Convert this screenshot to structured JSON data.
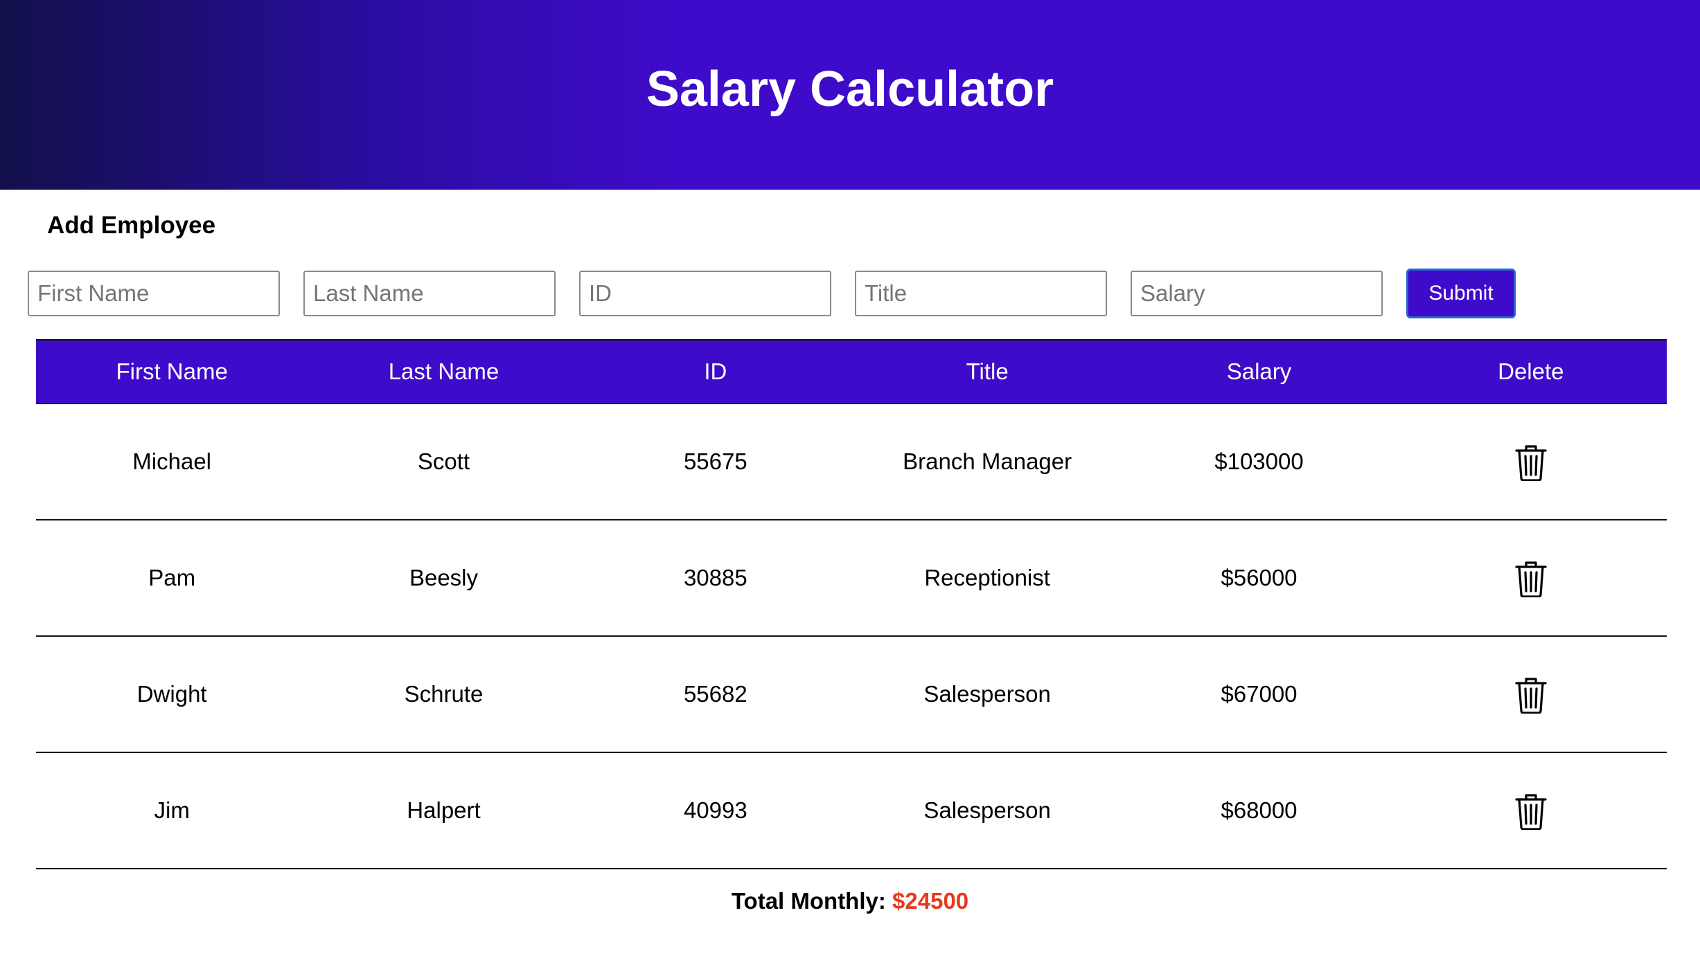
{
  "header": {
    "title": "Salary Calculator"
  },
  "form": {
    "title": "Add Employee",
    "first_name_placeholder": "First Name",
    "last_name_placeholder": "Last Name",
    "id_placeholder": "ID",
    "title_placeholder": "Title",
    "salary_placeholder": "Salary",
    "submit_label": "Submit"
  },
  "table": {
    "headers": [
      "First Name",
      "Last Name",
      "ID",
      "Title",
      "Salary",
      "Delete"
    ],
    "rows": [
      {
        "first": "Michael",
        "last": "Scott",
        "id": "55675",
        "title": "Branch Manager",
        "salary": "$103000",
        "delete_icon": "trash-icon"
      },
      {
        "first": "Pam",
        "last": "Beesly",
        "id": "30885",
        "title": "Receptionist",
        "salary": "$56000",
        "delete_icon": "trash-icon"
      },
      {
        "first": "Dwight",
        "last": "Schrute",
        "id": "55682",
        "title": "Salesperson",
        "salary": "$67000",
        "delete_icon": "trash-icon"
      },
      {
        "first": "Jim",
        "last": "Halpert",
        "id": "40993",
        "title": "Salesperson",
        "salary": "$68000",
        "delete_icon": "trash-icon"
      }
    ]
  },
  "footer": {
    "total_label": "Total Monthly:",
    "total_value": "$24500"
  },
  "colors": {
    "accent": "#3f0bca",
    "total_value": "#e53a1e"
  }
}
